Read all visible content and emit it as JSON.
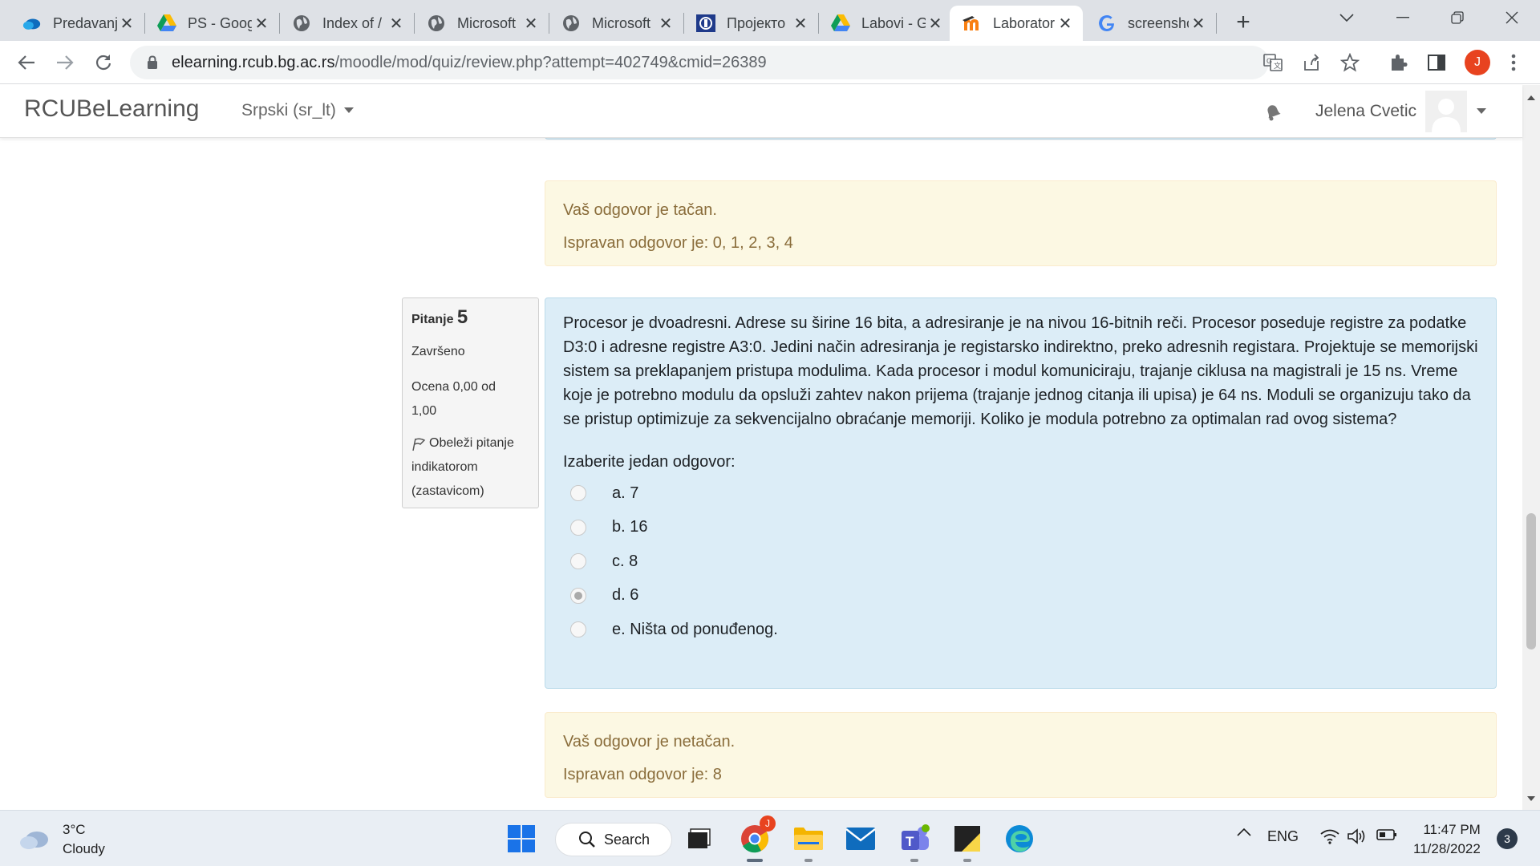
{
  "browser": {
    "tabs": [
      {
        "title": "Predavanja",
        "icon": "onedrive-icon"
      },
      {
        "title": "PS - Google Drive",
        "icon": "google-drive-icon"
      },
      {
        "title": "Index of /",
        "icon": "globe-icon"
      },
      {
        "title": "Microsoft",
        "icon": "globe-icon"
      },
      {
        "title": "Microsoft",
        "icon": "globe-icon"
      },
      {
        "title": "Пројекто",
        "icon": "site-logo-icon"
      },
      {
        "title": "Labovi - Google Drive",
        "icon": "google-drive-icon"
      },
      {
        "title": "Laboratorija",
        "icon": "moodle-icon",
        "active": true
      },
      {
        "title": "screenshot",
        "icon": "google-icon"
      }
    ],
    "close_glyph": "✕",
    "new_tab_glyph": "+",
    "url_host": "elearning.rcub.bg.ac.rs",
    "url_path": "/moodle/mod/quiz/review.php?attempt=402749&cmid=26389",
    "profile_initial": "J",
    "accent_color": "#e8431f"
  },
  "navbar": {
    "brand": "RCUBeLearning",
    "language": "Srpski (sr_lt)",
    "user_name": "Jelena Cvetic"
  },
  "previous_feedback": {
    "result": "Vaš odgovor je tačan.",
    "correct_answer": "Ispravan odgovor je: 0, 1, 2, 3, 4"
  },
  "question": {
    "label": "Pitanje",
    "number": "5",
    "state": "Završeno",
    "grade_line1": "Ocena 0,00 od",
    "grade_line2": "1,00",
    "flag_line1": "Obeleži pitanje",
    "flag_line2": "indikatorom",
    "flag_line3": "(zastavicom)",
    "text": "Procesor je dvoadresni. Adrese su širine 16 bita, a adresiranje je na nivou 16-bitnih reči. Procesor poseduje registre za podatke D3:0 i adresne registre A3:0. Jedini način adresiranja je registarsko indirektno, preko adresnih registara. Projektuje se memorijski sistem sa preklapanjem pristupa modulima. Kada procesor i modul komuniciraju, trajanje ciklusa na magistrali je 15 ns. Vreme koje je potrebno modulu da opsluži zahtev nakon prijema (trajanje jednog citanja ili upisa) je 64 ns. Moduli se organizuju tako da se pristup optimizuje za sekvencijalno obraćanje memoriji. Koliko je modula potrebno za optimalan rad ovog sistema?",
    "prompt": "Izaberite jedan odgovor:",
    "options": [
      {
        "label": "a. 7",
        "selected": false
      },
      {
        "label": "b. 16",
        "selected": false
      },
      {
        "label": "c. 8",
        "selected": false
      },
      {
        "label": "d. 6",
        "selected": true
      },
      {
        "label": "e. Ništa od ponuđenog.",
        "selected": false
      }
    ]
  },
  "feedback": {
    "result": "Vaš odgovor je netačan.",
    "correct_answer": "Ispravan odgovor je: 8"
  },
  "colors": {
    "question_bg": "#dcedf7",
    "feedback_bg": "#fcf8e3",
    "feedback_text": "#8a6d3b"
  },
  "taskbar": {
    "weather_temp": "3°C",
    "weather_desc": "Cloudy",
    "search_label": "Search",
    "language": "ENG",
    "time": "11:47 PM",
    "date": "11/28/2022",
    "notification_count": "3",
    "chrome_badge": "J"
  }
}
